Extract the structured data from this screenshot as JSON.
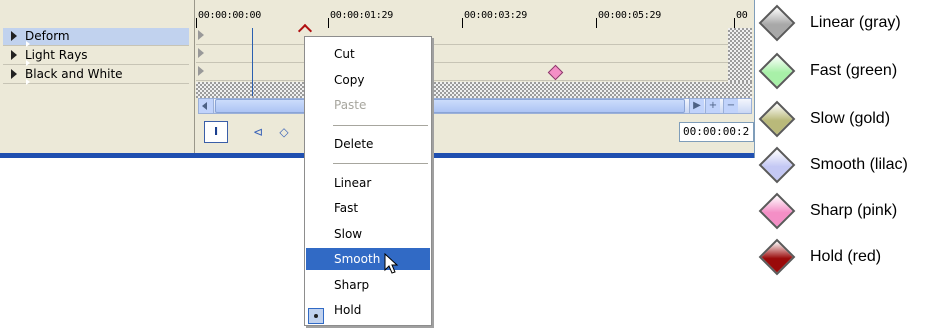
{
  "tracks": [
    {
      "label": "Deform"
    },
    {
      "label": "Light Rays"
    },
    {
      "label": "Black and White"
    }
  ],
  "ruler": {
    "ticks": [
      "00:00:00:00",
      "00:00:01:29",
      "00:00:03:29",
      "00:00:05:29",
      "00"
    ]
  },
  "toolbar": {
    "lock_label": "I",
    "time_value": "00:00:00:2"
  },
  "context_menu": {
    "items": [
      {
        "label": "Cut",
        "mnemonic_index": 2
      },
      {
        "label": "Copy"
      },
      {
        "label": "Paste",
        "disabled": true
      },
      {
        "label": "Delete"
      },
      {
        "label": "Linear"
      },
      {
        "label": "Fast"
      },
      {
        "label": "Slow"
      },
      {
        "label": "Smooth",
        "highlighted": true
      },
      {
        "label": "Sharp"
      },
      {
        "label": "Hold",
        "checked": true
      }
    ]
  },
  "legend": {
    "items": [
      {
        "label": "Linear (gray)",
        "color": "#a8a8a8"
      },
      {
        "label": "Fast (green)",
        "color": "#a8f0a8"
      },
      {
        "label": "Slow (gold)",
        "color": "#b9b97a"
      },
      {
        "label": "Smooth (lilac)",
        "color": "#c4c8f4"
      },
      {
        "label": "Sharp (pink)",
        "color": "#f48fc6"
      },
      {
        "label": "Hold (red)",
        "color": "#9a0a0a"
      }
    ]
  },
  "colors": {
    "highlight": "#316ac5",
    "playhead": "#2a5fb0",
    "keyframe_pink": "#f48fc6"
  }
}
